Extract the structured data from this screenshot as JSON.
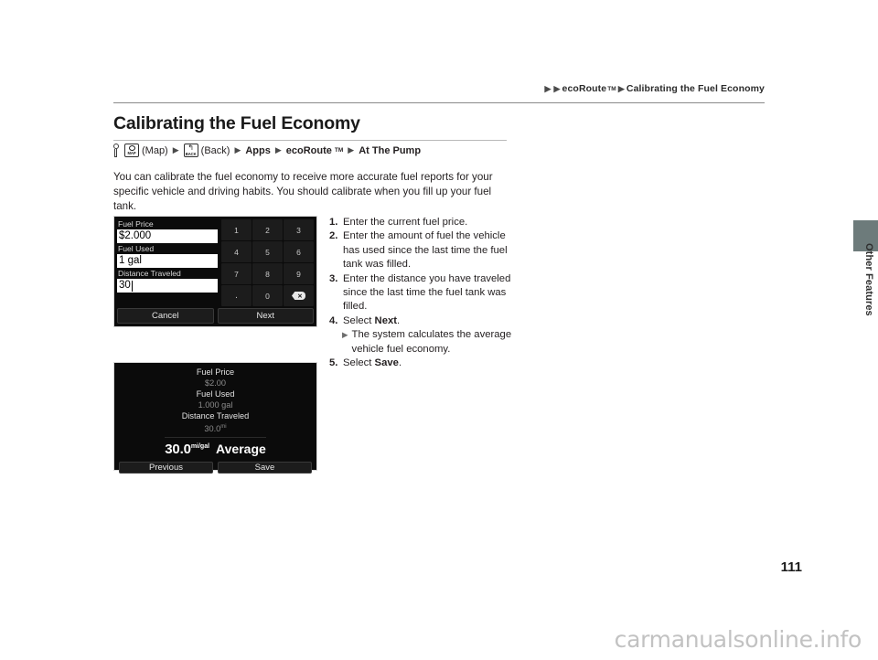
{
  "header": {
    "crumb_1": "ecoRoute",
    "crumb_1_sup": "TM",
    "crumb_2": "Calibrating the Fuel Economy",
    "triangle": "▶"
  },
  "page": {
    "title": "Calibrating the Fuel Economy",
    "number": "111",
    "side_tab_label": "Other Features",
    "watermark": "carmanualsonline.info"
  },
  "navpath": {
    "map_label": "(Map)",
    "map_icon_caption": "MAP",
    "back_label": "(Back)",
    "back_icon_caption": "BACK",
    "back_icon_glyph": "↰",
    "item_apps": "Apps",
    "item_ecoroute": "ecoRoute",
    "item_ecoroute_sup": "TM",
    "item_atthepump": "At The Pump",
    "triangle": "▶"
  },
  "body": {
    "paragraph": "You can calibrate the fuel economy to receive more accurate fuel reports for your specific vehicle and driving habits. You should calibrate when you fill up your fuel tank."
  },
  "screen_input": {
    "fields": [
      {
        "label": "Fuel Price",
        "value": "$2.000"
      },
      {
        "label": "Fuel Used",
        "value": "1 gal"
      },
      {
        "label": "Distance Traveled",
        "value": "30"
      }
    ],
    "keypad": [
      "1",
      "2",
      "3",
      "4",
      "5",
      "6",
      "7",
      "8",
      "9",
      ".",
      "0"
    ],
    "backspace_glyph": "✕",
    "cancel_label": "Cancel",
    "next_label": "Next"
  },
  "screen_result": {
    "rows": [
      {
        "label": "Fuel Price",
        "value": "$2.00"
      },
      {
        "label": "Fuel Used",
        "value": "1.000 gal"
      },
      {
        "label": "Distance Traveled",
        "value": "30.0",
        "unit": "mi"
      }
    ],
    "average_value": "30.0",
    "average_unit": "mi/gal",
    "average_label": "Average",
    "previous_label": "Previous",
    "save_label": "Save"
  },
  "steps": [
    {
      "num": "1.",
      "text": "Enter the current fuel price."
    },
    {
      "num": "2.",
      "text": "Enter the amount of fuel the vehicle has used since the last time the fuel tank was filled."
    },
    {
      "num": "3.",
      "text": "Enter the distance you have traveled since the last time the fuel tank was filled."
    },
    {
      "num": "4.",
      "text_pre": "Select ",
      "bold": "Next",
      "text_post": ".",
      "substep": "The system calculates the average vehicle fuel economy."
    },
    {
      "num": "5.",
      "text_pre": "Select ",
      "bold": "Save",
      "text_post": "."
    }
  ],
  "colors": {
    "screen_bg": "#0b0b0b",
    "side_tab": "#6d7b7b",
    "watermark": "#c2c2c2"
  }
}
